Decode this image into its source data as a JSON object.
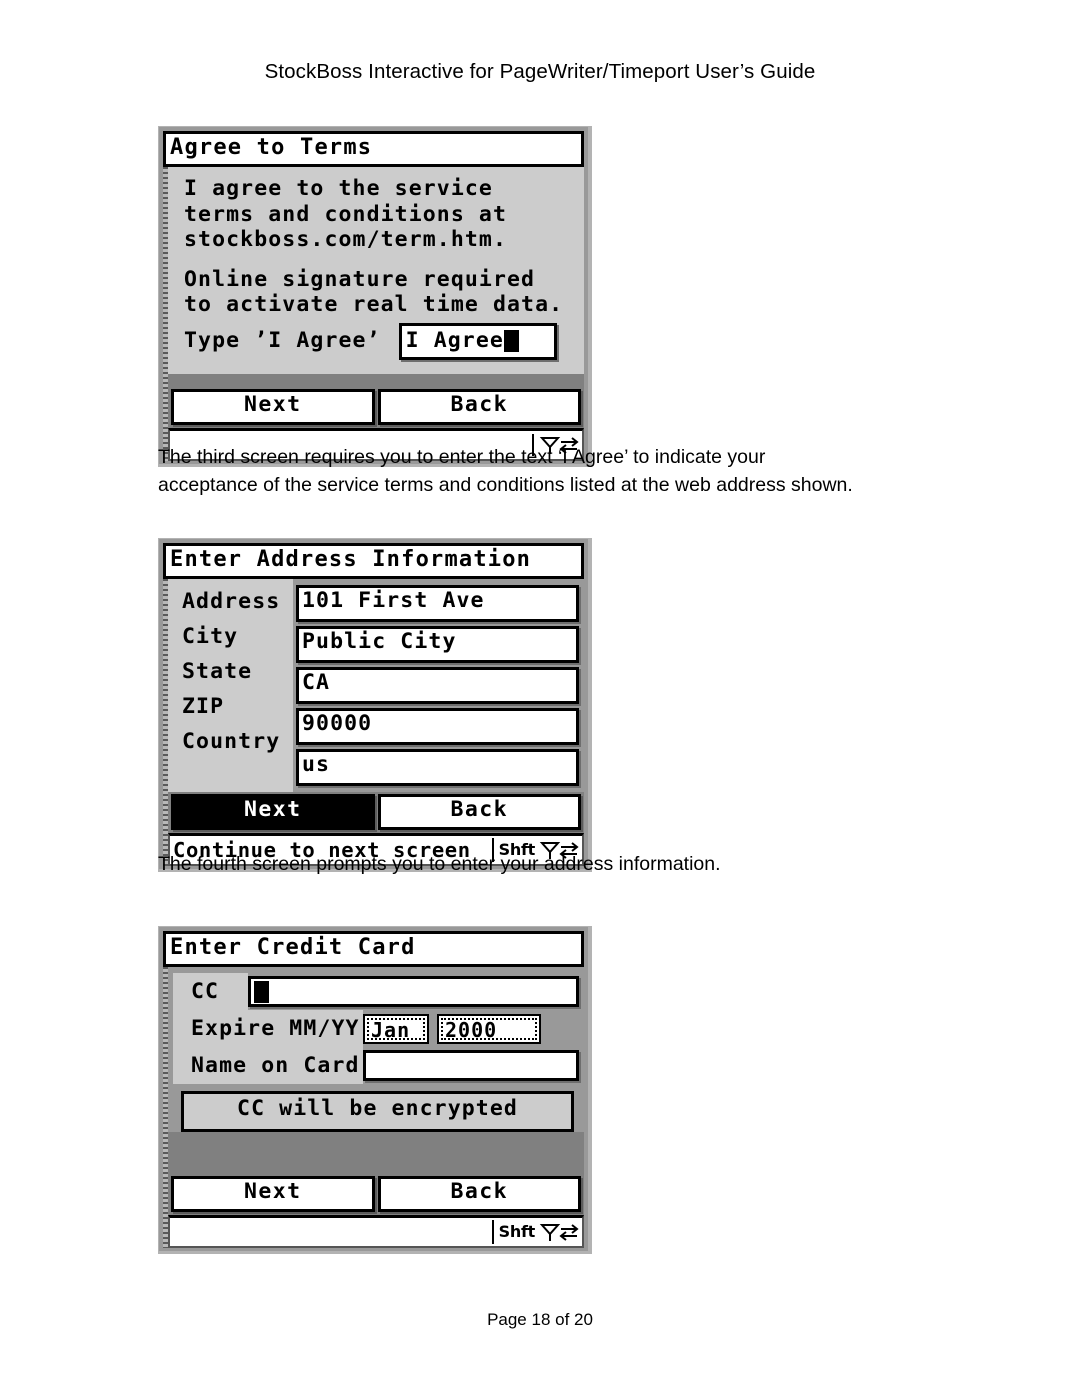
{
  "document": {
    "header_title": "StockBoss Interactive for PageWriter/Timeport User’s Guide",
    "footer": "Page 18 of 20"
  },
  "prose": {
    "paragraph_1_line_1": "The third screen requires you to enter the text ‘I Agree’ to indicate your",
    "paragraph_1_line_2": "acceptance of the service terms and conditions listed at the web address shown.",
    "paragraph_2_line_1": "The fourth screen prompts you to enter your address information."
  },
  "screen_agree": {
    "title": "Agree to Terms",
    "body_line_1": "I agree to the service",
    "body_line_2": "terms and conditions at",
    "body_line_3": "stockboss.com/term.htm.",
    "body_line_4": "Online signature required",
    "body_line_5": "to activate real time data.",
    "prompt_label": "Type ’I Agree’",
    "input_value": "I Agree",
    "next_label": "Next",
    "back_label": "Back",
    "status_text": "",
    "icons": {
      "antenna": "antenna-icon",
      "transfer": "transfer-arrows-icon"
    }
  },
  "screen_address": {
    "title": "Enter Address Information",
    "fields": [
      {
        "label": "Address",
        "value": "101 First Ave"
      },
      {
        "label": "City",
        "value": "Public City"
      },
      {
        "label": "State",
        "value": "CA"
      },
      {
        "label": "ZIP",
        "value": "90000"
      },
      {
        "label": "Country",
        "value": "us"
      }
    ],
    "next_label": "Next",
    "back_label": "Back",
    "status_text": "Continue to next screen",
    "shift_label": "Shft"
  },
  "screen_credit_card": {
    "title": "Enter Credit Card",
    "cc_label": "CC",
    "cc_value": "",
    "expire_label": "Expire MM/YY",
    "expire_month": "Jan",
    "expire_year": "2000",
    "name_label": "Name on Card",
    "name_value": "",
    "note": "CC will be encrypted",
    "next_label": "Next",
    "back_label": "Back",
    "status_text": "",
    "shift_label": "Shft"
  },
  "colors": {
    "page_background": "#ffffff",
    "text": "#000000",
    "lcd_panel": "#999999",
    "lcd_light": "#cccccc",
    "lcd_buttonbar": "#808080",
    "lcd_field": "#ffffff",
    "lcd_frame": "#b3b3b3"
  }
}
